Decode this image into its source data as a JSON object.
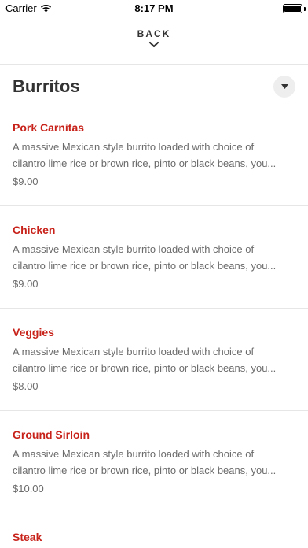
{
  "status_bar": {
    "carrier": "Carrier",
    "time": "8:17 PM"
  },
  "nav": {
    "back_label": "BACK"
  },
  "section": {
    "title": "Burritos"
  },
  "items": [
    {
      "name": "Pork Carnitas",
      "desc_line1": "A massive Mexican style burrito loaded with choice of",
      "desc_line2": "cilantro lime rice or brown rice, pinto or black beans, you...",
      "price": "$9.00"
    },
    {
      "name": "Chicken",
      "desc_line1": "A massive Mexican style burrito loaded with choice of",
      "desc_line2": "cilantro lime rice or brown rice, pinto or black beans, you...",
      "price": "$9.00"
    },
    {
      "name": "Veggies",
      "desc_line1": "A massive Mexican style burrito loaded with choice of",
      "desc_line2": "cilantro lime rice or brown rice, pinto or black beans, you...",
      "price": "$8.00"
    },
    {
      "name": "Ground Sirloin",
      "desc_line1": "A massive Mexican style burrito loaded with choice of",
      "desc_line2": "cilantro lime rice or brown rice, pinto or black beans, you...",
      "price": "$10.00"
    },
    {
      "name": "Steak",
      "desc_line1": "",
      "desc_line2": "",
      "price": ""
    }
  ],
  "colors": {
    "item_name": "#c8231b",
    "text_muted": "#6b6b6b",
    "divider": "#e6e6e6"
  },
  "icons": {
    "wifi": "wifi-icon",
    "battery": "battery-icon",
    "back": "chevron-down-icon",
    "dropdown": "caret-down-icon"
  }
}
